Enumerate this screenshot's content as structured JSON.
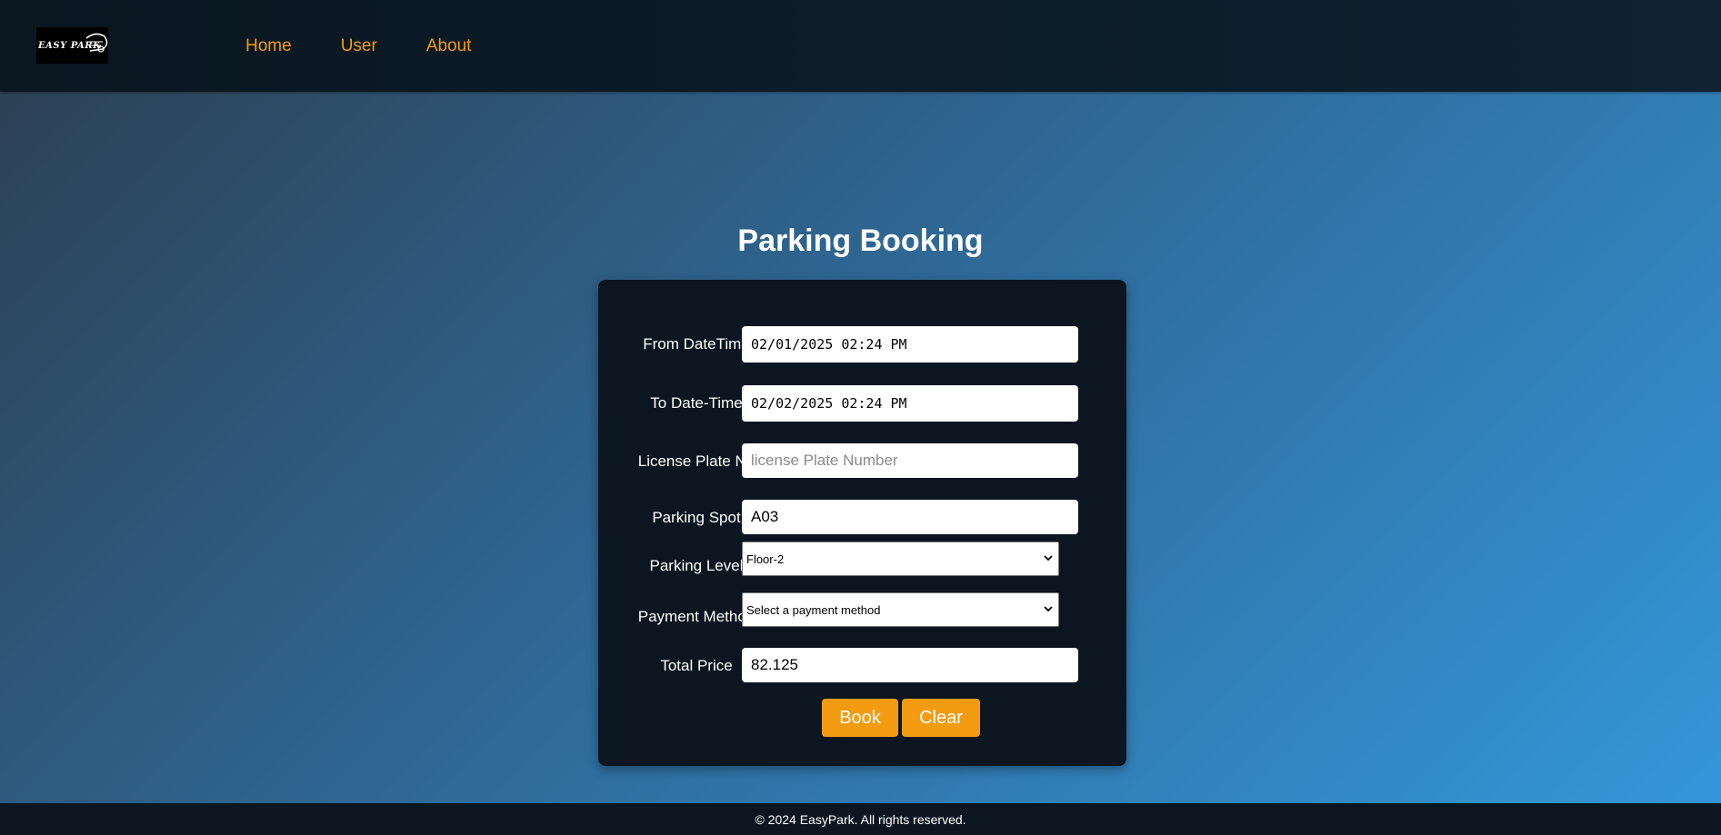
{
  "nav": {
    "logo_text": "EASY PARK",
    "links": [
      "Home",
      "User",
      "About"
    ]
  },
  "page_title": "Parking Booking",
  "form": {
    "from_label": "From DateTime",
    "from_value": "02/01/2025 02:24 PM",
    "to_label": "To Date-Time",
    "to_value": "02/02/2025 02:24 PM",
    "plate_label": "License Plate No",
    "plate_value": "",
    "plate_placeholder": "license Plate Number",
    "spot_label": "Parking Spot",
    "spot_value": "A03",
    "level_label": "Parking Level",
    "level_selected": "Floor-2",
    "payment_label": "Payment Method",
    "payment_selected": "Select a payment method",
    "price_label": "Total Price",
    "price_value": "82.125",
    "book_label": "Book",
    "clear_label": "Clear"
  },
  "footer": "© 2024 EasyPark. All rights reserved.",
  "colors": {
    "accent": "#f39c12",
    "card_bg": "#0b1620",
    "nav_bg": "#0e2230"
  },
  "icons": {
    "car": "car-logo-icon",
    "select_arrow": "chevron-down-icon"
  }
}
